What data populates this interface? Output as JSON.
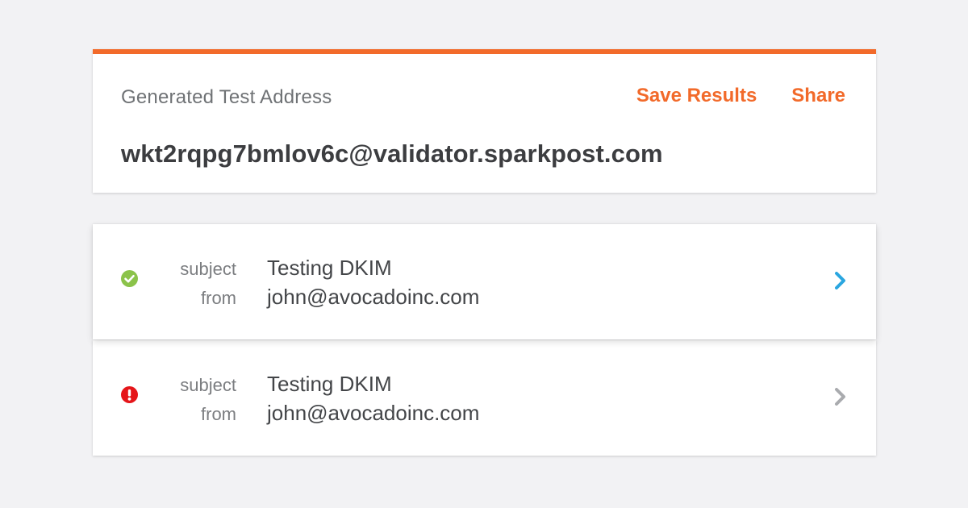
{
  "header": {
    "label": "Generated Test Address",
    "address": "wkt2rqpg7bmlov6c@validator.sparkpost.com",
    "actions": {
      "save": "Save Results",
      "share": "Share"
    }
  },
  "messages": [
    {
      "status": "pass",
      "status_icon": "check-circle-icon",
      "status_color": "#8bc34a",
      "subject_label": "subject",
      "from_label": "from",
      "subject": "Testing DKIM",
      "from": "john@avocadoinc.com",
      "chevron_color": "#2aa6e0"
    },
    {
      "status": "error",
      "status_icon": "exclamation-circle-icon",
      "status_color": "#e5161a",
      "subject_label": "subject",
      "from_label": "from",
      "subject": "Testing DKIM",
      "from": "john@avocadoinc.com",
      "chevron_color": "#a9abae"
    }
  ],
  "colors": {
    "accent": "#f26a2a",
    "background": "#f2f2f4"
  }
}
